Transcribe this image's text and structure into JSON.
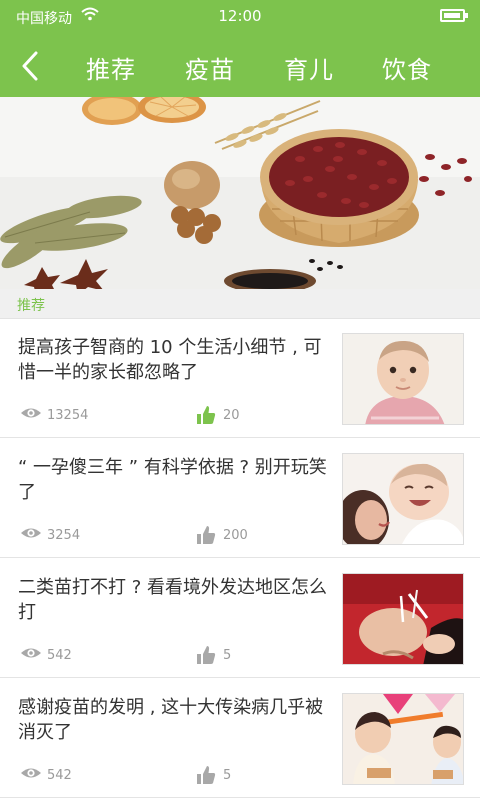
{
  "status_bar": {
    "carrier": "中国移动",
    "time": "12:00",
    "battery_level": 0.85
  },
  "nav": {
    "tabs": [
      {
        "label": "推荐",
        "active": true
      },
      {
        "label": "疫苗",
        "active": false
      },
      {
        "label": "育儿",
        "active": false
      },
      {
        "label": "饮食",
        "active": false
      }
    ]
  },
  "section": {
    "label": "推荐"
  },
  "articles": [
    {
      "title": "提高孩子智商的 10 个生活小细节 , 可惜一半的家长都忽略了",
      "views": "13254",
      "likes": "20",
      "liked": true
    },
    {
      "title": "“ 一孕傻三年 ” 有科学依据 ? 别开玩笑了",
      "views": "3254",
      "likes": "200",
      "liked": false
    },
    {
      "title": "二类苗打不打 ? 看看境外发达地区怎么打",
      "views": "542",
      "likes": "5",
      "liked": false
    },
    {
      "title": "感谢疫苗的发明 , 这十大传染病几乎被消灭了",
      "views": "542",
      "likes": "5",
      "liked": false
    }
  ],
  "colors": {
    "accent": "#7dc34d",
    "muted": "#9a9a9a",
    "like_active": "#7dc34d",
    "like_inactive": "#a8a8a8"
  },
  "icons": [
    "back-chevron-icon",
    "wifi-icon",
    "battery-icon",
    "eye-icon",
    "thumbs-up-icon"
  ]
}
